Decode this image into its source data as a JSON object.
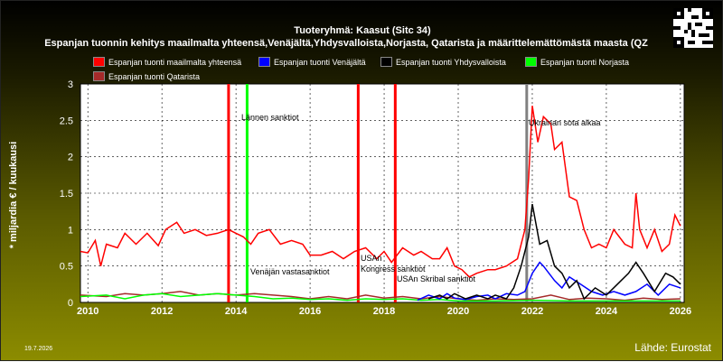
{
  "header": {
    "title": "Tuoteryhmä: Kaasut (Sitc 34)",
    "subtitle": "Espanjan tuonnin kehitys maailmalta yhteensä,Venäjältä,Yhdysvalloista,Norjasta, Qatarista ja määrittelemättömästä maasta (QZ"
  },
  "footer": {
    "date": "19.7.2026",
    "source": "Lähde: Eurostat"
  },
  "colors": {
    "total": "#ff0000",
    "russia": "#0000ff",
    "usa": "#000000",
    "norway": "#00ff00",
    "qatar": "#a52a2a",
    "event_red": "#ff0000",
    "event_green": "#00ff00",
    "event_gray": "#808080"
  },
  "legend": [
    {
      "label": "Espanjan tuonti maailmalta yhteensä",
      "color": "#ff0000"
    },
    {
      "label": "Espanjan tuonti Venäjältä",
      "color": "#0000ff"
    },
    {
      "label": "Espanjan tuonti Yhdysvalloista",
      "color": "#000000"
    },
    {
      "label": "Espanjan tuonti Norjasta",
      "color": "#00ff00"
    },
    {
      "label": "Espanjan tuonti Qatarista",
      "color": "#a52a2a"
    }
  ],
  "chart_data": {
    "type": "line",
    "title": "Tuoteryhmä: Kaasut (Sitc 34)",
    "ylabel": "* miljardia € / kuukausi",
    "xlabel": "",
    "xlim": [
      2009.8,
      2026.1
    ],
    "ylim": [
      0,
      3
    ],
    "x_ticks": [
      2010,
      2012,
      2014,
      2016,
      2018,
      2020,
      2022,
      2024,
      2026
    ],
    "y_ticks": [
      0,
      0.5,
      1,
      1.5,
      2,
      2.5,
      3
    ],
    "grid": true,
    "legend_position": "top",
    "series": [
      {
        "name": "Espanjan tuonti maailmalta yhteensä",
        "color": "#ff0000",
        "points": [
          [
            2009.8,
            0.7
          ],
          [
            2010.0,
            0.68
          ],
          [
            2010.2,
            0.85
          ],
          [
            2010.35,
            0.5
          ],
          [
            2010.5,
            0.8
          ],
          [
            2010.8,
            0.75
          ],
          [
            2011.0,
            0.95
          ],
          [
            2011.3,
            0.8
          ],
          [
            2011.6,
            0.95
          ],
          [
            2011.9,
            0.78
          ],
          [
            2012.1,
            1.0
          ],
          [
            2012.4,
            1.1
          ],
          [
            2012.6,
            0.95
          ],
          [
            2012.9,
            1.0
          ],
          [
            2013.2,
            0.92
          ],
          [
            2013.5,
            0.95
          ],
          [
            2013.8,
            1.0
          ],
          [
            2014.0,
            0.95
          ],
          [
            2014.2,
            0.9
          ],
          [
            2014.4,
            0.8
          ],
          [
            2014.6,
            0.95
          ],
          [
            2014.9,
            1.0
          ],
          [
            2015.2,
            0.8
          ],
          [
            2015.5,
            0.85
          ],
          [
            2015.8,
            0.8
          ],
          [
            2016.0,
            0.65
          ],
          [
            2016.3,
            0.65
          ],
          [
            2016.6,
            0.7
          ],
          [
            2016.9,
            0.6
          ],
          [
            2017.2,
            0.7
          ],
          [
            2017.5,
            0.75
          ],
          [
            2017.8,
            0.6
          ],
          [
            2018.0,
            0.7
          ],
          [
            2018.2,
            0.55
          ],
          [
            2018.5,
            0.75
          ],
          [
            2018.8,
            0.65
          ],
          [
            2019.0,
            0.7
          ],
          [
            2019.3,
            0.6
          ],
          [
            2019.5,
            0.6
          ],
          [
            2019.7,
            0.75
          ],
          [
            2019.9,
            0.5
          ],
          [
            2020.1,
            0.45
          ],
          [
            2020.3,
            0.35
          ],
          [
            2020.5,
            0.4
          ],
          [
            2020.8,
            0.45
          ],
          [
            2021.0,
            0.45
          ],
          [
            2021.3,
            0.5
          ],
          [
            2021.6,
            0.6
          ],
          [
            2021.8,
            1.0
          ],
          [
            2021.9,
            1.7
          ],
          [
            2022.0,
            2.7
          ],
          [
            2022.15,
            2.2
          ],
          [
            2022.3,
            2.55
          ],
          [
            2022.5,
            2.45
          ],
          [
            2022.6,
            2.1
          ],
          [
            2022.8,
            2.2
          ],
          [
            2023.0,
            1.45
          ],
          [
            2023.2,
            1.4
          ],
          [
            2023.4,
            1.0
          ],
          [
            2023.6,
            0.75
          ],
          [
            2023.8,
            0.8
          ],
          [
            2024.0,
            0.75
          ],
          [
            2024.2,
            1.0
          ],
          [
            2024.5,
            0.8
          ],
          [
            2024.7,
            0.75
          ],
          [
            2024.8,
            1.5
          ],
          [
            2024.9,
            1.0
          ],
          [
            2025.1,
            0.75
          ],
          [
            2025.3,
            1.0
          ],
          [
            2025.5,
            0.7
          ],
          [
            2025.7,
            0.8
          ],
          [
            2025.85,
            1.2
          ],
          [
            2026.0,
            1.05
          ]
        ]
      },
      {
        "name": "Espanjan tuonti Venäjältä",
        "color": "#0000ff",
        "points": [
          [
            2018.9,
            0.03
          ],
          [
            2019.2,
            0.1
          ],
          [
            2019.5,
            0.05
          ],
          [
            2019.7,
            0.12
          ],
          [
            2019.9,
            0.06
          ],
          [
            2020.2,
            0.04
          ],
          [
            2020.5,
            0.08
          ],
          [
            2020.8,
            0.1
          ],
          [
            2021.0,
            0.05
          ],
          [
            2021.3,
            0.12
          ],
          [
            2021.6,
            0.1
          ],
          [
            2021.8,
            0.15
          ],
          [
            2022.0,
            0.4
          ],
          [
            2022.2,
            0.55
          ],
          [
            2022.3,
            0.5
          ],
          [
            2022.6,
            0.3
          ],
          [
            2022.8,
            0.2
          ],
          [
            2023.0,
            0.35
          ],
          [
            2023.3,
            0.25
          ],
          [
            2023.6,
            0.15
          ],
          [
            2023.9,
            0.1
          ],
          [
            2024.2,
            0.15
          ],
          [
            2024.5,
            0.1
          ],
          [
            2024.8,
            0.15
          ],
          [
            2025.1,
            0.25
          ],
          [
            2025.4,
            0.1
          ],
          [
            2025.7,
            0.25
          ],
          [
            2026.0,
            0.2
          ]
        ]
      },
      {
        "name": "Espanjan tuonti Yhdysvalloista",
        "color": "#000000",
        "points": [
          [
            2019.2,
            0.05
          ],
          [
            2019.5,
            0.1
          ],
          [
            2019.7,
            0.05
          ],
          [
            2019.9,
            0.12
          ],
          [
            2020.2,
            0.05
          ],
          [
            2020.5,
            0.1
          ],
          [
            2020.8,
            0.05
          ],
          [
            2021.0,
            0.1
          ],
          [
            2021.3,
            0.05
          ],
          [
            2021.5,
            0.2
          ],
          [
            2021.7,
            0.5
          ],
          [
            2021.9,
            0.9
          ],
          [
            2022.0,
            1.35
          ],
          [
            2022.2,
            0.8
          ],
          [
            2022.4,
            0.85
          ],
          [
            2022.6,
            0.5
          ],
          [
            2022.8,
            0.4
          ],
          [
            2023.0,
            0.2
          ],
          [
            2023.2,
            0.3
          ],
          [
            2023.4,
            0.05
          ],
          [
            2023.7,
            0.2
          ],
          [
            2024.0,
            0.1
          ],
          [
            2024.3,
            0.25
          ],
          [
            2024.6,
            0.4
          ],
          [
            2024.8,
            0.55
          ],
          [
            2025.0,
            0.4
          ],
          [
            2025.3,
            0.15
          ],
          [
            2025.6,
            0.4
          ],
          [
            2025.8,
            0.35
          ],
          [
            2026.0,
            0.25
          ]
        ]
      },
      {
        "name": "Espanjan tuonti Norjasta",
        "color": "#00ff00",
        "points": [
          [
            2009.8,
            0.08
          ],
          [
            2010.5,
            0.1
          ],
          [
            2011.0,
            0.05
          ],
          [
            2011.5,
            0.1
          ],
          [
            2012.0,
            0.12
          ],
          [
            2012.5,
            0.08
          ],
          [
            2013.0,
            0.1
          ],
          [
            2013.5,
            0.12
          ],
          [
            2014.0,
            0.1
          ],
          [
            2014.5,
            0.08
          ],
          [
            2015.0,
            0.05
          ],
          [
            2015.5,
            0.06
          ],
          [
            2016.0,
            0.04
          ],
          [
            2016.5,
            0.05
          ],
          [
            2017.0,
            0.03
          ],
          [
            2017.5,
            0.05
          ],
          [
            2018.0,
            0.04
          ],
          [
            2018.5,
            0.05
          ],
          [
            2019.0,
            0.03
          ],
          [
            2019.5,
            0.04
          ],
          [
            2020.0,
            0.02
          ],
          [
            2021.0,
            0.02
          ],
          [
            2022.0,
            0.03
          ],
          [
            2023.0,
            0.02
          ],
          [
            2024.0,
            0.02
          ],
          [
            2025.0,
            0.02
          ],
          [
            2026.0,
            0.02
          ]
        ]
      },
      {
        "name": "Espanjan tuonti Qatarista",
        "color": "#a52a2a",
        "points": [
          [
            2009.8,
            0.1
          ],
          [
            2010.5,
            0.08
          ],
          [
            2011.0,
            0.12
          ],
          [
            2011.5,
            0.1
          ],
          [
            2012.0,
            0.12
          ],
          [
            2012.5,
            0.15
          ],
          [
            2013.0,
            0.1
          ],
          [
            2013.5,
            0.12
          ],
          [
            2014.0,
            0.1
          ],
          [
            2014.5,
            0.12
          ],
          [
            2015.0,
            0.1
          ],
          [
            2015.5,
            0.08
          ],
          [
            2016.0,
            0.05
          ],
          [
            2016.5,
            0.08
          ],
          [
            2017.0,
            0.05
          ],
          [
            2017.5,
            0.1
          ],
          [
            2018.0,
            0.06
          ],
          [
            2018.5,
            0.08
          ],
          [
            2019.0,
            0.05
          ],
          [
            2019.5,
            0.08
          ],
          [
            2020.0,
            0.05
          ],
          [
            2020.5,
            0.03
          ],
          [
            2021.0,
            0.05
          ],
          [
            2021.5,
            0.04
          ],
          [
            2022.0,
            0.05
          ],
          [
            2022.5,
            0.1
          ],
          [
            2023.0,
            0.04
          ],
          [
            2023.5,
            0.06
          ],
          [
            2024.0,
            0.05
          ],
          [
            2024.5,
            0.03
          ],
          [
            2025.0,
            0.06
          ],
          [
            2025.5,
            0.04
          ],
          [
            2026.0,
            0.05
          ]
        ]
      }
    ],
    "events": [
      {
        "x": 2013.8,
        "color": "#ff0000",
        "label": ""
      },
      {
        "x": 2014.3,
        "color": "#00ff00",
        "label": "Lännen sanktiot"
      },
      {
        "x": 2014.3,
        "color": "#00ff00",
        "label": "Venäjän vastasanktiot"
      },
      {
        "x": 2017.3,
        "color": "#ff0000",
        "label": "USAn"
      },
      {
        "x": 2017.3,
        "color": "#ff0000",
        "label": "Kongress sanktiot"
      },
      {
        "x": 2018.3,
        "color": "#ff0000",
        "label": "USAn Skribal sanktiot"
      },
      {
        "x": 2021.85,
        "color": "#808080",
        "label": "Ukrainan sota alkaa"
      }
    ]
  }
}
